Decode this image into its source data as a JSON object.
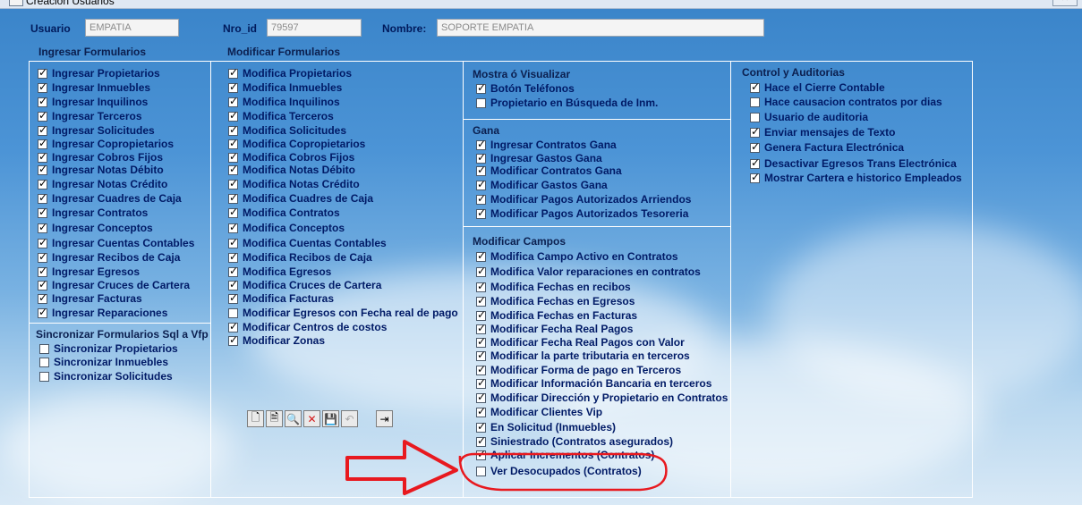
{
  "window": {
    "title": "Creación Usuarios",
    "close": "✕"
  },
  "header": {
    "usuario_label": "Usuario",
    "usuario_value": "EMPATIA",
    "nro_label": "Nro_id",
    "nro_value": "79597",
    "nombre_label": "Nombre:",
    "nombre_value": "SOPORTE EMPATIA"
  },
  "col1": {
    "title": "Ingresar Formularios",
    "items": [
      {
        "label": "Ingresar Propietarios",
        "checked": true
      },
      {
        "label": "Ingresar Inmuebles",
        "checked": true
      },
      {
        "label": "Ingresar Inquilinos",
        "checked": true
      },
      {
        "label": "Ingresar Terceros",
        "checked": true
      },
      {
        "label": "Ingresar Solicitudes",
        "checked": true
      },
      {
        "label": "Ingresar Copropietarios",
        "checked": true
      },
      {
        "label": "Ingresar Cobros Fijos",
        "checked": true
      },
      {
        "label": "Ingresar Notas Débito",
        "checked": true
      },
      {
        "label": "Ingresar Notas Crédito",
        "checked": true
      },
      {
        "label": "Ingresar Cuadres de Caja",
        "checked": true
      },
      {
        "label": "Ingresar Contratos",
        "checked": true
      },
      {
        "label": "Ingresar Conceptos",
        "checked": true
      },
      {
        "label": "Ingresar Cuentas Contables",
        "checked": true
      },
      {
        "label": "Ingresar Recibos de Caja",
        "checked": true
      },
      {
        "label": "Ingresar Egresos",
        "checked": true
      },
      {
        "label": "Ingresar Cruces de Cartera",
        "checked": true
      },
      {
        "label": "Ingresar Facturas",
        "checked": true
      },
      {
        "label": "Ingresar Reparaciones",
        "checked": true
      }
    ]
  },
  "sync": {
    "title": "Sincronizar Formularios Sql a Vfp",
    "items": [
      {
        "label": "Sincronizar Propietarios",
        "checked": false
      },
      {
        "label": "Sincronizar Inmuebles",
        "checked": false
      },
      {
        "label": "Sincronizar Solicitudes",
        "checked": false
      }
    ]
  },
  "col2": {
    "title": "Modificar Formularios",
    "items": [
      {
        "label": "Modifica Propietarios",
        "checked": true
      },
      {
        "label": "Modifica Inmuebles",
        "checked": true
      },
      {
        "label": "Modifica Inquilinos",
        "checked": true
      },
      {
        "label": "Modifica Terceros",
        "checked": true
      },
      {
        "label": "Modifica Solicitudes",
        "checked": true
      },
      {
        "label": "Modifica Copropietarios",
        "checked": true
      },
      {
        "label": "Modifica Cobros Fijos",
        "checked": true
      },
      {
        "label": "Modifica Notas Débito",
        "checked": true
      },
      {
        "label": "Modifica Notas Crédito",
        "checked": true
      },
      {
        "label": "Modifica Cuadres de Caja",
        "checked": true
      },
      {
        "label": "Modifica Contratos",
        "checked": true
      },
      {
        "label": "Modifica Conceptos",
        "checked": true
      },
      {
        "label": "Modifica Cuentas Contables",
        "checked": true
      },
      {
        "label": "Modifica Recibos de Caja",
        "checked": true
      },
      {
        "label": "Modifica Egresos",
        "checked": true
      },
      {
        "label": "Modifica Cruces de Cartera",
        "checked": true
      },
      {
        "label": "Modifica Facturas",
        "checked": true
      },
      {
        "label": "Modificar Egresos con Fecha real de pago",
        "checked": false
      },
      {
        "label": "Modificar Centros de costos",
        "checked": true
      },
      {
        "label": "Modificar Zonas",
        "checked": true
      }
    ]
  },
  "mostrar": {
    "title": "Mostra ó Visualizar",
    "items": [
      {
        "label": "Botón Teléfonos",
        "checked": true
      },
      {
        "label": "Propietario en Búsqueda de Inm.",
        "checked": false
      }
    ]
  },
  "gana": {
    "title": "Gana",
    "items": [
      {
        "label": "Ingresar Contratos Gana",
        "checked": true
      },
      {
        "label": "Ingresar Gastos Gana",
        "checked": true
      },
      {
        "label": "Modificar Contratos Gana",
        "checked": true
      },
      {
        "label": "Modificar Gastos Gana",
        "checked": true
      },
      {
        "label": "Modificar Pagos Autorizados Arriendos",
        "checked": true
      },
      {
        "label": "Modificar Pagos Autorizados Tesoreria",
        "checked": true
      }
    ]
  },
  "campos": {
    "title": "Modificar Campos",
    "items": [
      {
        "label": "Modifica Campo Activo en Contratos",
        "checked": true
      },
      {
        "label": "Modifica Valor reparaciones en contratos",
        "checked": true
      },
      {
        "label": "Modifica Fechas en recibos",
        "checked": true
      },
      {
        "label": "Modifica Fechas en Egresos",
        "checked": true
      },
      {
        "label": "Modifica Fechas en Facturas",
        "checked": true
      },
      {
        "label": "Modificar Fecha Real Pagos",
        "checked": true
      },
      {
        "label": "Modificar Fecha Real Pagos con Valor",
        "checked": true
      },
      {
        "label": "Modificar la parte tributaria en terceros",
        "checked": true
      },
      {
        "label": "Modificar Forma de pago en Terceros",
        "checked": true
      },
      {
        "label": "Modificar Información Bancaria en terceros",
        "checked": true
      },
      {
        "label": "Modificar Dirección y Propietario en Contratos",
        "checked": true
      },
      {
        "label": "Modificar Clientes Vip",
        "checked": true
      },
      {
        "label": "En Solicitud (Inmuebles)",
        "checked": true
      },
      {
        "label": "Siniestrado (Contratos asegurados)",
        "checked": true
      },
      {
        "label": "Aplicar Incrementos (Contratos)",
        "checked": true
      },
      {
        "label": "Ver Desocupados (Contratos)",
        "checked": false
      }
    ]
  },
  "control": {
    "title": "Control y Auditorias",
    "items": [
      {
        "label": "Hace el Cierre Contable",
        "checked": true
      },
      {
        "label": "Hace causacion contratos por dias",
        "checked": false
      },
      {
        "label": "Usuario de auditoria",
        "checked": false
      },
      {
        "label": "Enviar mensajes de Texto",
        "checked": true
      },
      {
        "label": "Genera Factura Electrónica",
        "checked": true
      },
      {
        "label": "Desactivar Egresos Trans Electrónica",
        "checked": true
      },
      {
        "label": "Mostrar Cartera e historico Empleados",
        "checked": true
      }
    ]
  },
  "toolbar": {
    "buttons": [
      {
        "icon": "new-icon",
        "glyph": "🗋",
        "enabled": true
      },
      {
        "icon": "document-icon",
        "glyph": "🗎",
        "enabled": true
      },
      {
        "icon": "binoculars-icon",
        "glyph": "🔍",
        "enabled": true
      },
      {
        "icon": "delete-icon",
        "glyph": "✕",
        "enabled": true
      },
      {
        "icon": "save-icon",
        "glyph": "💾",
        "enabled": false
      },
      {
        "icon": "undo-icon",
        "glyph": "↶",
        "enabled": false
      },
      {
        "icon": "exit-icon",
        "glyph": "⇥",
        "enabled": true
      }
    ]
  },
  "annotation": {
    "arrow_color": "#e8191f"
  }
}
